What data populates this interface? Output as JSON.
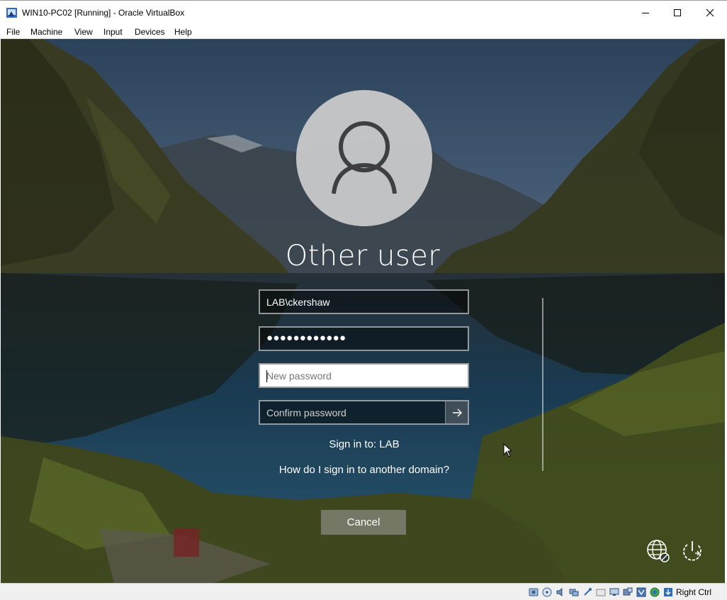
{
  "window": {
    "title": "WIN10-PC02 [Running] - Oracle VirtualBox",
    "icon": "virtualbox-icon",
    "controls": [
      "minimize-icon",
      "maximize-icon",
      "close-icon"
    ]
  },
  "menu": {
    "items": [
      "File",
      "Machine",
      "View",
      "Input",
      "Devices",
      "Help"
    ]
  },
  "login": {
    "user_name": "Other user",
    "avatar_icon": "user-icon",
    "username_value": "LAB\\ckershaw",
    "password_masked": "●●●●●●●●●●●●",
    "new_password_placeholder": "New password",
    "confirm_password_placeholder": "Confirm password",
    "submit_icon": "arrow-right-icon",
    "sign_in_to": "Sign in to: LAB",
    "domain_link": "How do I sign in to another domain?",
    "cancel_label": "Cancel",
    "network_icon": "network-icon",
    "power_icon": "power-icon"
  },
  "statusbar": {
    "icons": [
      "hard-disk-icon",
      "optical-drive-icon",
      "audio-icon",
      "network-adapter-icon",
      "usb-icon",
      "shared-folders-icon",
      "display-icon",
      "video-capture-icon",
      "virtualization-icon",
      "mouse-integration-icon",
      "download-icon"
    ],
    "host_key": "Right Ctrl"
  }
}
